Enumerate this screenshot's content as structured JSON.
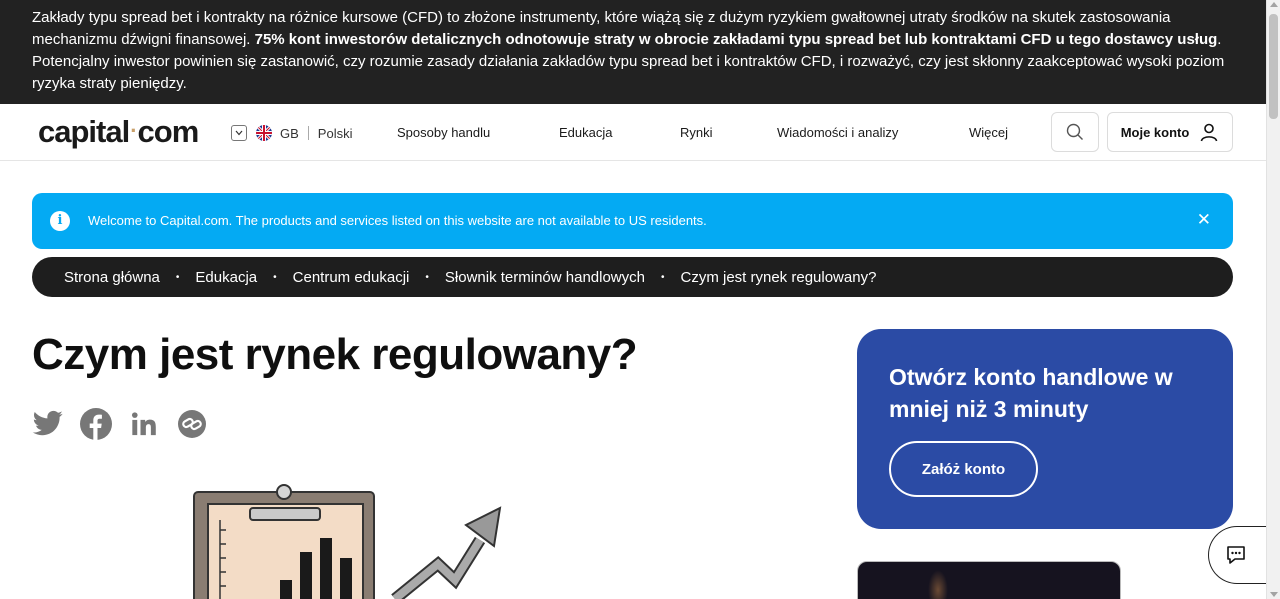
{
  "risk_banner": {
    "part1": "Zakłady typu spread bet i kontrakty na różnice kursowe (CFD) to złożone instrumenty, które wiążą się z dużym ryzykiem gwałtownej utraty środków na skutek zastosowania mechanizmu dźwigni finansowej. ",
    "bold": "75% kont inwestorów detalicznych odnotowuje straty w obrocie zakładami typu spread bet lub kontraktami CFD u tego dostawcy usług",
    "part2": ". Potencjalny inwestor powinien się zastanowić, czy rozumie zasady działania zakładów typu spread bet i kontraktów CFD, i rozważyć, czy jest skłonny zaakceptować wysoki poziom ryzyka straty pieniędzy."
  },
  "header": {
    "logo_left": "capital",
    "logo_dot": "·",
    "logo_right": "com",
    "country": "GB",
    "language": "Polski",
    "nav": [
      "Sposoby handlu",
      "Edukacja",
      "Rynki",
      "Wiadomości i analizy",
      "Więcej"
    ],
    "account_label": "Moje konto"
  },
  "info_bar": {
    "icon": "info-icon",
    "message": "Welcome to Capital.com. The products and services listed on this website are not available to US residents.",
    "close": "✕"
  },
  "breadcrumb": [
    "Strona główna",
    "Edukacja",
    "Centrum edukacji",
    "Słownik terminów handlowych",
    "Czym jest rynek regulowany?"
  ],
  "breadcrumb_separator": "•",
  "main": {
    "title": "Czym jest rynek regulowany?",
    "share_icons": [
      "twitter-icon",
      "facebook-icon",
      "linkedin-icon",
      "link-icon"
    ]
  },
  "cta": {
    "heading": "Otwórz konto handlowe w mniej niż 3 minuty",
    "button": "Załóż konto"
  },
  "colors": {
    "banner_bg": "#222222",
    "info_bg": "#04aaf3",
    "cta_bg": "#2b4ba5",
    "breadcrumb_bg": "#1e1e1e"
  }
}
